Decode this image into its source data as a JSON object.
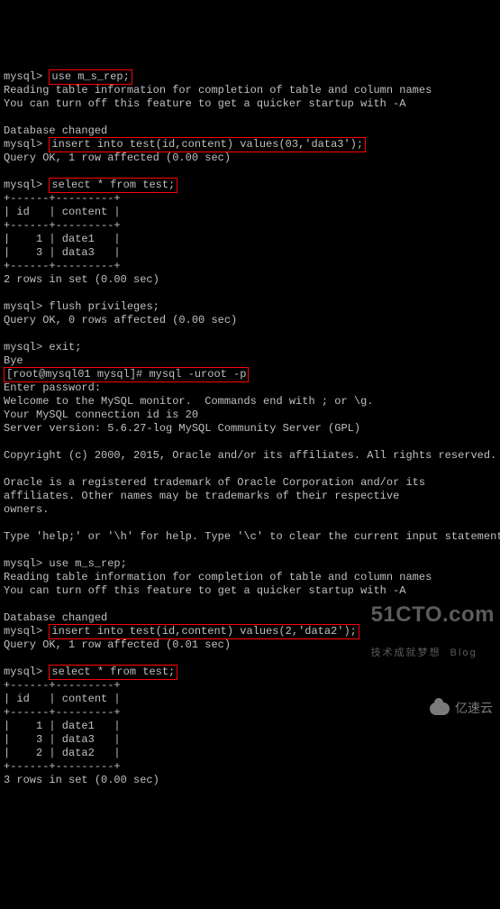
{
  "prompt_mysql": "mysql>",
  "prompt_shell": "[root@mysql01 mysql]#",
  "cmd": {
    "use_db_1": "use m_s_rep;",
    "insert_1": "insert into test(id,content) values(03,'data3');",
    "select_1": "select * from test;",
    "flush": "flush privileges;",
    "exit": "exit;",
    "shell_mysql": "mysql -uroot -p",
    "use_db_2": "use m_s_rep;",
    "insert_2": "insert into test(id,content) values(2,'data2');",
    "select_2": "select * from test;"
  },
  "out": {
    "reading_info": "Reading table information for completion of table and column names",
    "turn_off": "You can turn off this feature to get a quicker startup with -A",
    "db_changed": "Database changed",
    "query_ok_1": "Query OK, 1 row affected (0.00 sec)",
    "query_ok_001": "Query OK, 1 row affected (0.01 sec)",
    "query_ok_0": "Query OK, 0 rows affected (0.00 sec)",
    "bye": "Bye",
    "enter_pw": "Enter password:",
    "welcome": "Welcome to the MySQL monitor.  Commands end with ; or \\g.",
    "conn_id": "Your MySQL connection id is 20",
    "server_ver": "Server version: 5.6.27-log MySQL Community Server (GPL)",
    "copyright": "Copyright (c) 2000, 2015, Oracle and/or its affiliates. All rights reserved.",
    "oracle_1": "Oracle is a registered trademark of Oracle Corporation and/or its",
    "oracle_2": "affiliates. Other names may be trademarks of their respective",
    "oracle_3": "owners.",
    "help": "Type 'help;' or '\\h' for help. Type '\\c' to clear the current input statement.",
    "rows_2": "2 rows in set (0.00 sec)",
    "rows_3": "3 rows in set (0.00 sec)"
  },
  "table1": {
    "border": "+------+---------+",
    "header": "| id   | content |",
    "r1": "|    1 | date1   |",
    "r2": "|    3 | data3   |"
  },
  "table2": {
    "border": "+------+---------+",
    "header": "| id   | content |",
    "r1": "|    1 | date1   |",
    "r2": "|    3 | data3   |",
    "r3": "|    2 | data2   |"
  },
  "watermark": {
    "cto_big": "51CTO.com",
    "cto_small": "技术成就梦想  Blog",
    "yisu": "亿速云"
  }
}
